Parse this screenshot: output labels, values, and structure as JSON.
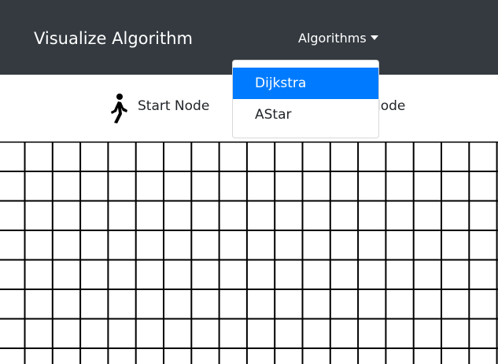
{
  "navbar": {
    "brand": "Visualize Algorithm",
    "dropdown_label": "Algorithms"
  },
  "legend": {
    "start_node_label": "Start Node",
    "end_node_label_visible": "lode"
  },
  "dropdown_menu": {
    "items": [
      {
        "label": "Dijkstra",
        "active": true
      },
      {
        "label": "AStar",
        "active": false
      }
    ]
  },
  "colors": {
    "navbar_bg": "#343a40",
    "active_item_bg": "#007bff",
    "grid_line": "#000000"
  },
  "icons": {
    "start_node": "walking-person-icon",
    "dropdown_caret": "caret-down-icon"
  }
}
